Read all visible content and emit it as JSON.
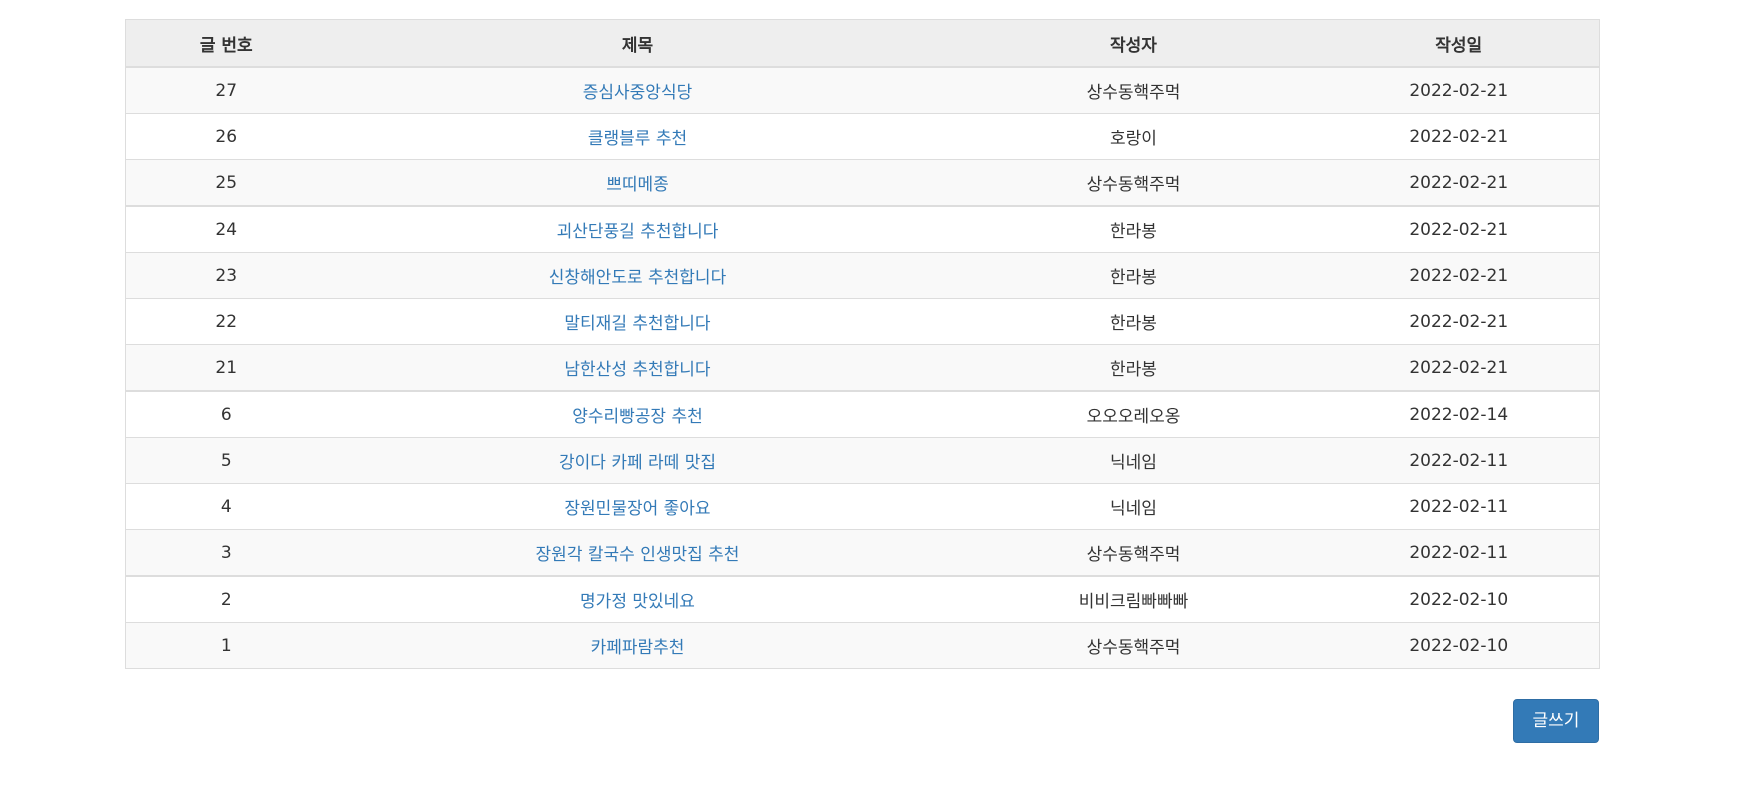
{
  "board": {
    "headers": {
      "number": "글 번호",
      "title": "제목",
      "writer": "작성자",
      "date": "작성일"
    },
    "rows": [
      {
        "number": "27",
        "title": "증심사중앙식당",
        "writer": "상수동핵주먹",
        "date": "2022-02-21"
      },
      {
        "number": "26",
        "title": "클랭블루 추천",
        "writer": "호랑이",
        "date": "2022-02-21"
      },
      {
        "number": "25",
        "title": "쁘띠메종",
        "writer": "상수동핵주먹",
        "date": "2022-02-21"
      },
      {
        "number": "24",
        "title": "괴산단풍길 추천합니다",
        "writer": "한라봉",
        "date": "2022-02-21"
      },
      {
        "number": "23",
        "title": "신창해안도로 추천합니다",
        "writer": "한라봉",
        "date": "2022-02-21"
      },
      {
        "number": "22",
        "title": "말티재길 추천합니다",
        "writer": "한라봉",
        "date": "2022-02-21"
      },
      {
        "number": "21",
        "title": "남한산성 추천합니다",
        "writer": "한라봉",
        "date": "2022-02-21"
      },
      {
        "number": "6",
        "title": "양수리빵공장 추천",
        "writer": "오오오레오옹",
        "date": "2022-02-14"
      },
      {
        "number": "5",
        "title": "강이다 카페 라떼 맛집",
        "writer": "닉네임",
        "date": "2022-02-11"
      },
      {
        "number": "4",
        "title": "장원민물장어 좋아요",
        "writer": "닉네임",
        "date": "2022-02-11"
      },
      {
        "number": "3",
        "title": "장원각 칼국수 인생맛집 추천",
        "writer": "상수동핵주먹",
        "date": "2022-02-11"
      },
      {
        "number": "2",
        "title": "명가정 맛있네요",
        "writer": "비비크림빠빠빠",
        "date": "2022-02-10"
      },
      {
        "number": "1",
        "title": "카페파람추천",
        "writer": "상수동핵주먹",
        "date": "2022-02-10"
      }
    ]
  },
  "actions": {
    "write_label": "글쓰기"
  },
  "colors": {
    "link": "#337ab7",
    "button": "#337ab7",
    "header_bg": "#eeeeee",
    "stripe_bg": "#f9f9f9"
  }
}
